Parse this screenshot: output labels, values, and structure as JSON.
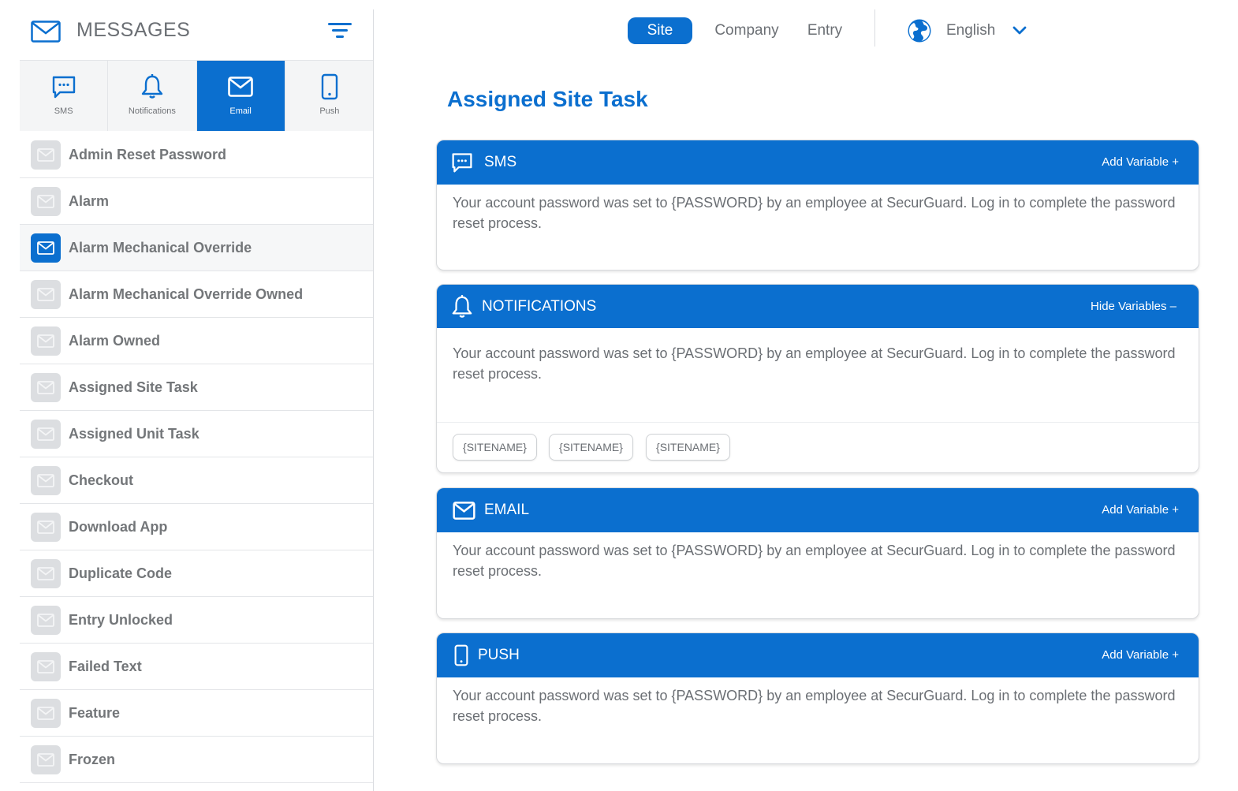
{
  "sidebar": {
    "title": "MESSAGES",
    "tabs": [
      {
        "label": "SMS",
        "icon": "sms-icon"
      },
      {
        "label": "Notifications",
        "icon": "bell-icon"
      },
      {
        "label": "Email",
        "icon": "envelope-icon",
        "active": true
      },
      {
        "label": "Push",
        "icon": "phone-icon"
      }
    ],
    "items": [
      {
        "label": "Admin Reset Password"
      },
      {
        "label": "Alarm"
      },
      {
        "label": "Alarm Mechanical Override",
        "selected": true
      },
      {
        "label": "Alarm Mechanical Override Owned"
      },
      {
        "label": "Alarm Owned"
      },
      {
        "label": "Assigned Site Task"
      },
      {
        "label": "Assigned Unit Task"
      },
      {
        "label": "Checkout"
      },
      {
        "label": "Download App"
      },
      {
        "label": "Duplicate Code"
      },
      {
        "label": "Entry Unlocked"
      },
      {
        "label": "Failed Text"
      },
      {
        "label": "Feature"
      },
      {
        "label": "Frozen"
      }
    ]
  },
  "nav": {
    "site": "Site",
    "company": "Company",
    "entry": "Entry",
    "language": "English"
  },
  "main": {
    "title": "Assigned Site Task",
    "cards": {
      "sms": {
        "title": "SMS",
        "action": "Add Variable +",
        "body": "Your account password was set to {PASSWORD} by an employee at SecurGuard. Log in to complete the password reset process."
      },
      "notifications": {
        "title": "NOTIFICATIONS",
        "action": "Hide Variables  –",
        "body": "Your account password was set to {PASSWORD} by an employee at SecurGuard. Log in to complete the password reset process.",
        "chips": [
          "{SITENAME}",
          "{SITENAME}",
          "{SITENAME}"
        ]
      },
      "email": {
        "title": "EMAIL",
        "action": "Add Variable +",
        "body": "Your account password was set to {PASSWORD} by an employee at SecurGuard. Log in to complete the password reset process."
      },
      "push": {
        "title": "PUSH",
        "action": "Add Variable +",
        "body": "Your account password was set to {PASSWORD} by an employee at SecurGuard. Log in to complete the password reset process."
      }
    }
  },
  "colors": {
    "accent": "#0b6fcf",
    "text": "#6b6f74",
    "border": "#e3e5e8"
  }
}
